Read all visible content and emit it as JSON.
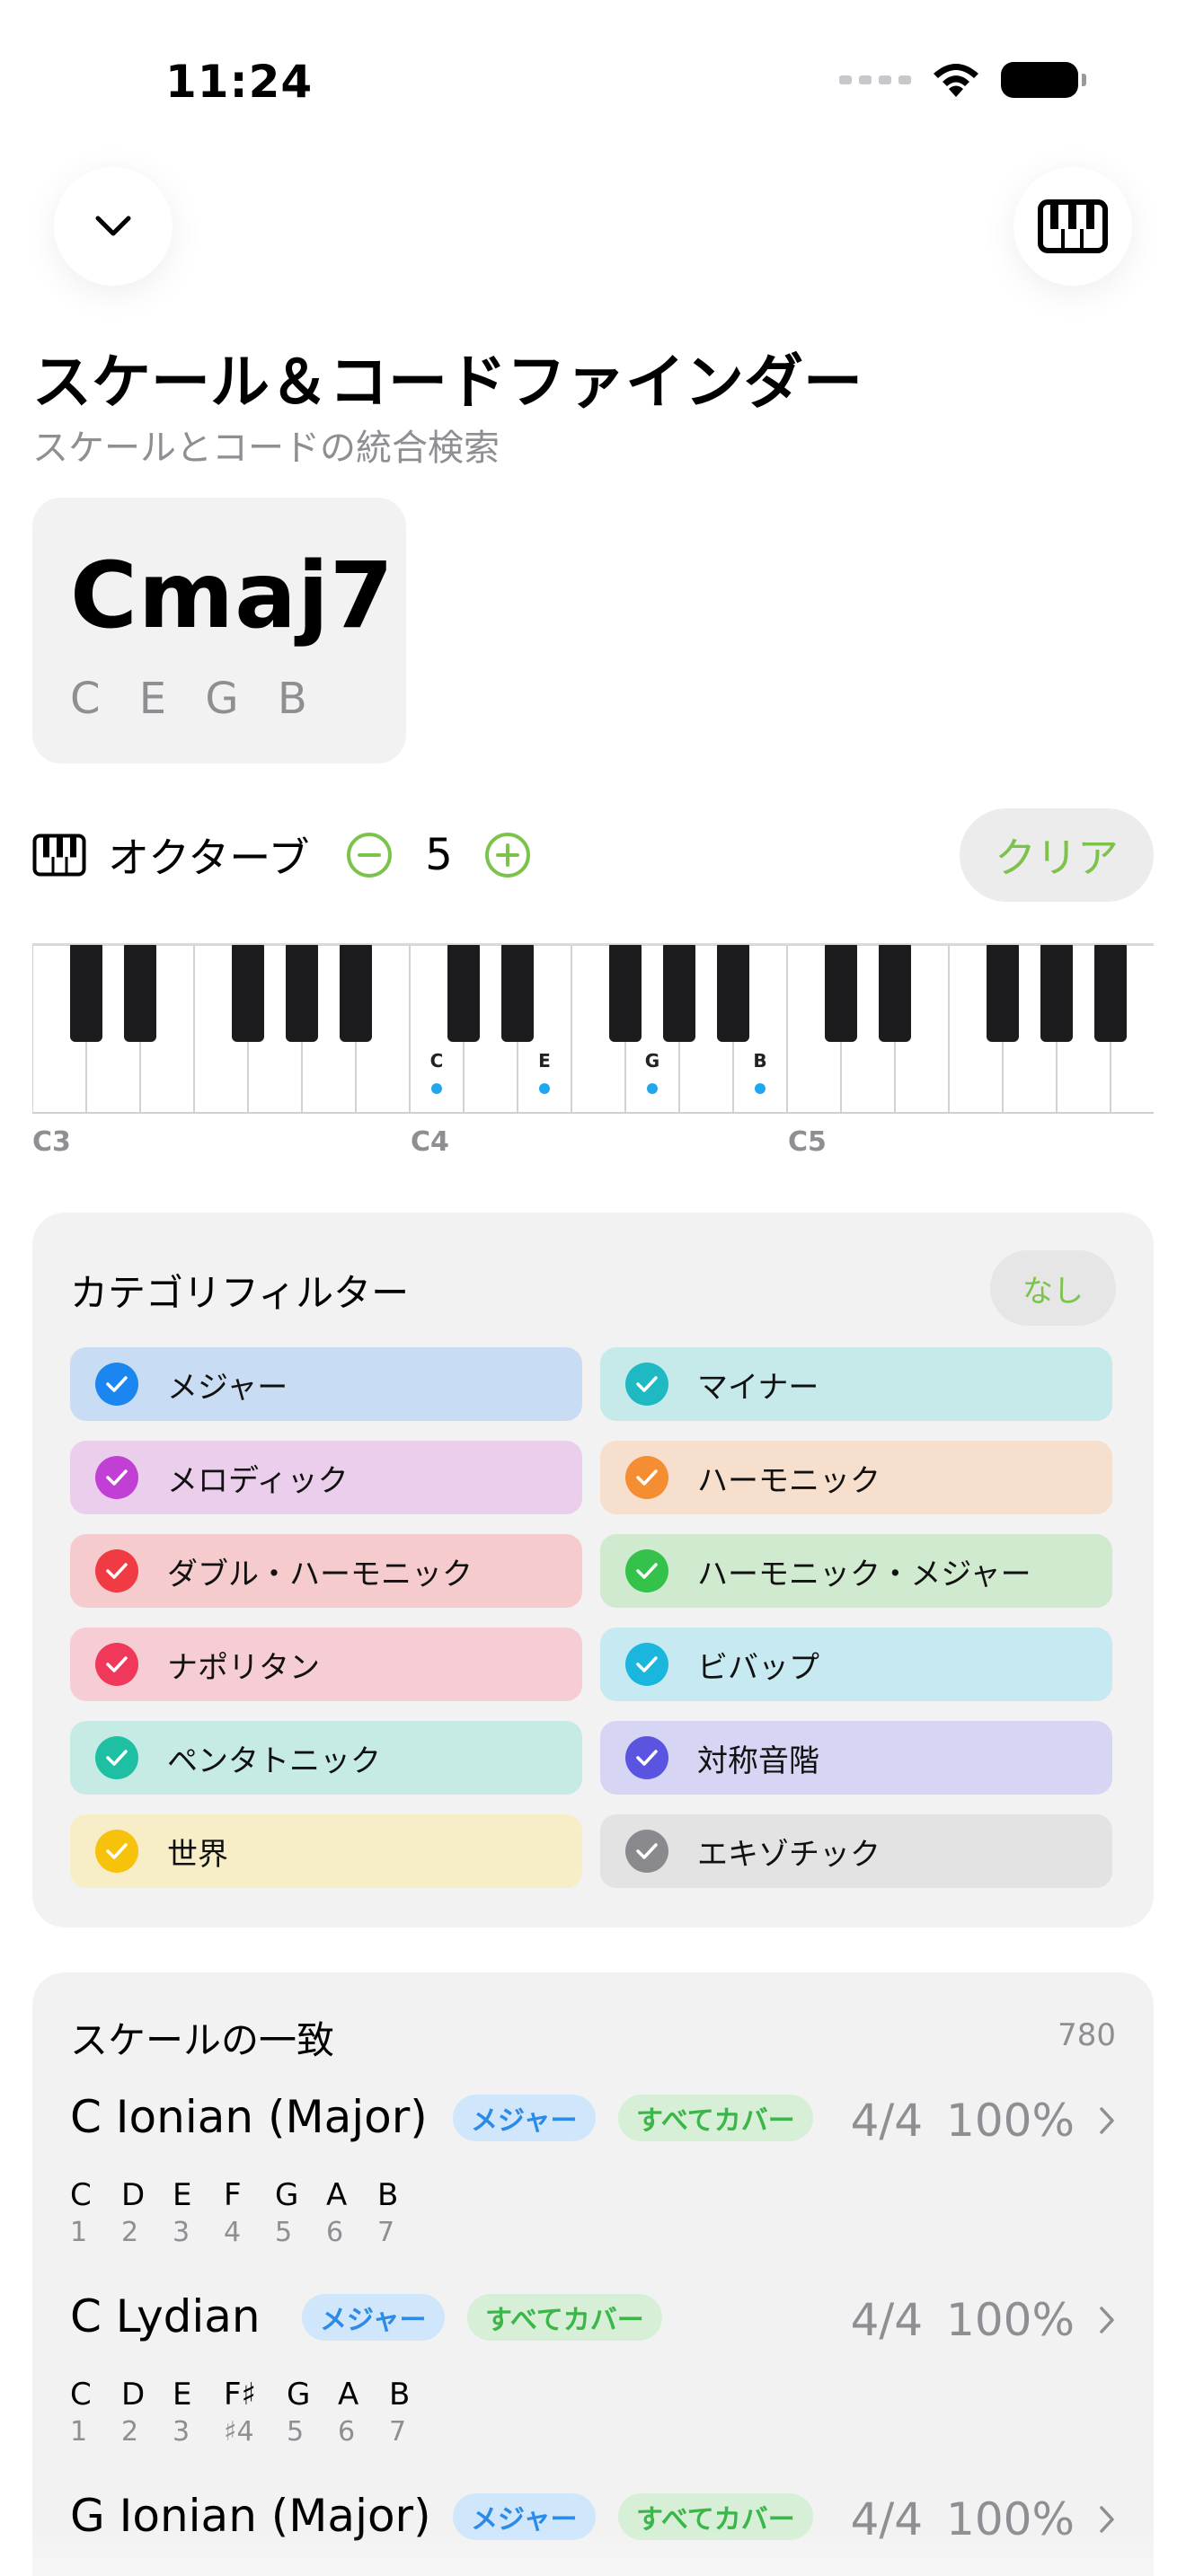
{
  "status": {
    "time": "11:24"
  },
  "header": {
    "title": "スケール＆コードファインダー",
    "subtitle": "スケールとコードの統合検索"
  },
  "chord": {
    "name": "Cmaj7",
    "notes": "C E G B"
  },
  "octave": {
    "label": "オクターブ",
    "value": "5",
    "clear_label": "クリア"
  },
  "keyboard": {
    "octave_labels": [
      "C3",
      "C4",
      "C5"
    ],
    "highlighted": [
      {
        "note": "C"
      },
      {
        "note": "E"
      },
      {
        "note": "G"
      },
      {
        "note": "B"
      }
    ],
    "accent_color": "#1fa8f0"
  },
  "filter": {
    "title": "カテゴリフィルター",
    "none_label": "なし",
    "categories": [
      {
        "label": "メジャー",
        "bg": "#c8ddf3",
        "color": "#1b86f0"
      },
      {
        "label": "マイナー",
        "bg": "#c6e9e9",
        "color": "#1fb9c4"
      },
      {
        "label": "メロディック",
        "bg": "#ebcdec",
        "color": "#c23fd6"
      },
      {
        "label": "ハーモニック",
        "bg": "#f6dfcc",
        "color": "#f58e32"
      },
      {
        "label": "ダブル・ハーモニック",
        "bg": "#f6cbcd",
        "color": "#f03a44"
      },
      {
        "label": "ハーモニック・メジャー",
        "bg": "#cfeacf",
        "color": "#34c24b"
      },
      {
        "label": "ナポリタン",
        "bg": "#f6cdd4",
        "color": "#f0385a"
      },
      {
        "label": "ビバップ",
        "bg": "#c7e9f1",
        "color": "#1ab6dd"
      },
      {
        "label": "ペンタトニック",
        "bg": "#c5ebe4",
        "color": "#1fbfa3"
      },
      {
        "label": "対称音階",
        "bg": "#d6d5f3",
        "color": "#5a54e0"
      },
      {
        "label": "世界",
        "bg": "#f7edc6",
        "color": "#f7c20c"
      },
      {
        "label": "エキゾチック",
        "bg": "#e3e3e3",
        "color": "#8a8a8e"
      }
    ]
  },
  "matches": {
    "title": "スケールの一致",
    "count": "780",
    "rows": [
      {
        "name": "C Ionian (Major)",
        "badge1": "メジャー",
        "badge2": "すべてカバー",
        "ratio": "4/4",
        "percent": "100%",
        "notes": [
          "C",
          "D",
          "E",
          "F",
          "G",
          "A",
          "B"
        ],
        "degrees": [
          "1",
          "2",
          "3",
          "4",
          "5",
          "6",
          "7"
        ]
      },
      {
        "name": "C Lydian",
        "badge1": "メジャー",
        "badge2": "すべてカバー",
        "ratio": "4/4",
        "percent": "100%",
        "notes": [
          "C",
          "D",
          "E",
          "F♯",
          "G",
          "A",
          "B"
        ],
        "degrees": [
          "1",
          "2",
          "3",
          "♯4",
          "5",
          "6",
          "7"
        ]
      },
      {
        "name": "G Ionian (Major)",
        "badge1": "メジャー",
        "badge2": "すべてカバー",
        "ratio": "4/4",
        "percent": "100%",
        "notes": [],
        "degrees": []
      }
    ]
  }
}
